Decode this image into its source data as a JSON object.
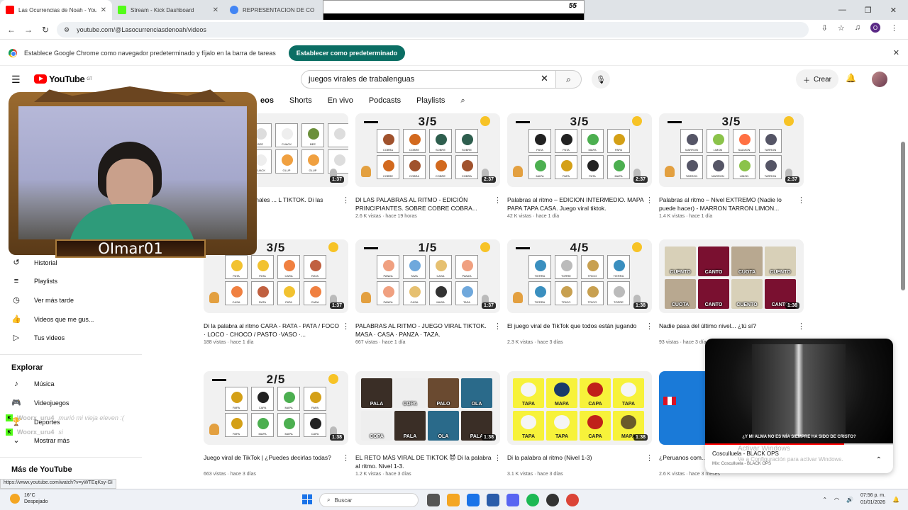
{
  "browser": {
    "tabs": [
      {
        "label": "Las Ocurrencias de Noah - YouT",
        "color": "#ff0000",
        "active": true
      },
      {
        "label": "Stream - Kick Dashboard",
        "color": "#53fc18",
        "active": false
      },
      {
        "label": "REPRESENTACION DE CO",
        "color": "#4285f4",
        "active": false
      }
    ],
    "overlay_number": "55",
    "url": "youtube.com/@Lasocurrenciasdenoah/videos",
    "profile_initial": "O",
    "infobar_text": "Establece Google Chrome como navegador predeterminado y fíjalo en la barra de tareas",
    "infobar_button": "Establecer como predeterminado"
  },
  "youtube": {
    "logo": "YouTube",
    "logo_region": "GT",
    "search_value": "juegos virales de trabalenguas",
    "create_label": "Crear",
    "channel_tabs": [
      "eos",
      "Shorts",
      "En vivo",
      "Podcasts",
      "Playlists"
    ]
  },
  "sidebar": {
    "items_top": [
      {
        "label": "Historial",
        "icon": "history-icon"
      },
      {
        "label": "Playlists",
        "icon": "playlist-icon"
      },
      {
        "label": "Ver más tarde",
        "icon": "clock-icon"
      },
      {
        "label": "Videos que me gus...",
        "icon": "like-icon"
      },
      {
        "label": "Tus videos",
        "icon": "video-icon"
      }
    ],
    "explore_heading": "Explorar",
    "items_explore": [
      {
        "label": "Música",
        "icon": "music-icon"
      },
      {
        "label": "Videojuegos",
        "icon": "gamepad-icon"
      },
      {
        "label": "Deportes",
        "icon": "trophy-icon"
      },
      {
        "label": "Mostrar más",
        "icon": "chevron-down-icon"
      }
    ],
    "more_heading": "Más de YouTube"
  },
  "webcam": {
    "name": "OImar01"
  },
  "chat": [
    {
      "user": "Woorx_uru4",
      "msg": "murió mi vieja eleven :("
    },
    {
      "user": "Woorx_uru4",
      "msg": "si"
    }
  ],
  "videos": [
    {
      "score": "",
      "title": "con sonidos de animales ... L TIKTOK. Di las palabras a...",
      "meta": "horas",
      "duration": "1:37",
      "type": "grid",
      "cells": [
        "BEE",
        "CUACK",
        "BEE",
        "",
        "CUACK",
        "GLUP",
        "GLUP",
        ""
      ],
      "colors": [
        "#ddd",
        "#eee",
        "#6b8f3a",
        "#ddd",
        "#eee",
        "#f0a040",
        "#f0a040",
        "#ddd"
      ]
    },
    {
      "score": "3/5",
      "title": "DI LAS PALABRAS AL RITMO - EDICIÓN PRINCIPIANTES. SOBRE COBRE COBRA...",
      "meta": "2.6 K vistas · hace 19 horas",
      "duration": "2:37",
      "type": "grid",
      "cells": [
        "COBRA",
        "COBRE",
        "SOBRE",
        "SOBRE",
        "COBRE",
        "COBRA",
        "COBRE",
        "COBRA"
      ],
      "colors": [
        "#a0522d",
        "#d2691e",
        "#2e5e4e",
        "#2e5e4e",
        "#d2691e",
        "#a0522d",
        "#d2691e",
        "#a0522d"
      ]
    },
    {
      "score": "3/5",
      "title": "Palabras al ritmo – EDICION INTERMEDIO. MAPA PAPA TAPA CASA. Juego viral tiktok.",
      "meta": "42 K vistas · hace 1 día",
      "duration": "2:37",
      "type": "grid",
      "cells": [
        "PATA",
        "PATA",
        "MAPA",
        "PAPA",
        "MAPA",
        "PAPA",
        "PATA",
        "MAPA"
      ],
      "colors": [
        "#222",
        "#222",
        "#4caf50",
        "#d4a017",
        "#4caf50",
        "#d4a017",
        "#222",
        "#4caf50"
      ]
    },
    {
      "score": "3/5",
      "title": "Palabras al ritmo – Nivel EXTREMO (Nadie lo puede hacer) - MARRON TARRON LIMON...",
      "meta": "1.4 K vistas · hace 1 día",
      "duration": "2:37",
      "type": "grid",
      "cells": [
        "MARRON",
        "LIMON",
        "SALMON",
        "TARRON",
        "TARRON",
        "MARRON",
        "LIMON",
        "TARRON"
      ],
      "colors": [
        "#556",
        "#8bc34a",
        "#ff7043",
        "#556",
        "#556",
        "#556",
        "#8bc34a",
        "#556"
      ]
    },
    {
      "score": "3/5",
      "title": "Di la palabra al ritmo CARA - RATA - PATA / FOCO · LOCO · CHOCO / PASTO ·VASO ·...",
      "meta": "188 vistas · hace 1 día",
      "duration": "1:37",
      "type": "grid",
      "cells": [
        "PATA",
        "PATA",
        "CARA",
        "RATA",
        "CASA",
        "RATA",
        "PATA",
        "CARA"
      ],
      "colors": [
        "#f2c230",
        "#f2c230",
        "#f08040",
        "#c06040",
        "#f08040",
        "#c06040",
        "#f2c230",
        "#f08040"
      ]
    },
    {
      "score": "1/5",
      "title": "PALABRAS AL RITMO - JUEGO VIRAL TIKTOK. MASA · CASA · PANZA · TAZA.",
      "meta": "667 vistas · hace 1 día",
      "duration": "1:37",
      "type": "grid",
      "cells": [
        "PANZA",
        "TAZA",
        "CASA",
        "PANZA",
        "PANZA",
        "CASA",
        "MASA",
        "TAZA"
      ],
      "colors": [
        "#f0a080",
        "#6fa8dc",
        "#e6c070",
        "#f0a080",
        "#f0a080",
        "#e6c070",
        "#333",
        "#6fa8dc"
      ]
    },
    {
      "score": "4/5",
      "title": "El juego viral de TikTok que todos están jugando",
      "meta": "2.3 K vistas · hace 3 días",
      "duration": "1:38",
      "type": "grid",
      "cells": [
        "TIERRA",
        "TORRE",
        "TRIGO",
        "TIERRA",
        "TIERRA",
        "TRIGO",
        "TRIGO",
        "TORRE"
      ],
      "colors": [
        "#3a8fbf",
        "#bbb",
        "#c8a050",
        "#3a8fbf",
        "#3a8fbf",
        "#c8a050",
        "#c8a050",
        "#bbb"
      ]
    },
    {
      "score": "",
      "title": "Nadie pasa del último nivel... ¿tú sí?",
      "meta": "93 vistas · hace 3 días",
      "duration": "1:38",
      "type": "photo",
      "cells": [
        "CUENTO",
        "CANTO",
        "CUOTA",
        "CUENTO",
        "CUOTA",
        "CANTO",
        "CUENTO",
        "CANTO"
      ],
      "colors": [
        "#d8d0b8",
        "#7a1030",
        "#b8a890",
        "#d8d0b8",
        "#b8a890",
        "#7a1030",
        "#d8d0b8",
        "#7a1030"
      ]
    },
    {
      "score": "2/5",
      "title": "Juego viral de TikTok | ¿Puedes decirlas todas?",
      "meta": "663 vistas · hace 3 días",
      "duration": "1:38",
      "type": "grid",
      "cells": [
        "PAPA",
        "CAPA",
        "MAPA",
        "PAPA",
        "PAPA",
        "MAPA",
        "MAPA",
        "CAPA"
      ],
      "colors": [
        "#d4a017",
        "#222",
        "#4caf50",
        "#d4a017",
        "#d4a017",
        "#4caf50",
        "#4caf50",
        "#222"
      ]
    },
    {
      "score": "",
      "title": "EL RETO MÁS VIRAL DE TIKTOK 😈 Di la palabra al ritmo. Nivel 1-3.",
      "meta": "1.2 K vistas · hace 3 días",
      "duration": "1:38",
      "type": "photo",
      "cells": [
        "PALA",
        "COPA",
        "PALO",
        "OLA",
        "COPA",
        "PALA",
        "OLA",
        "PALA"
      ],
      "colors": [
        "#3a2e26",
        "#eee",
        "#6a4a30",
        "#2a6a8a",
        "#eee",
        "#3a2e26",
        "#2a6a8a",
        "#3a2e26"
      ]
    },
    {
      "score": "",
      "title": "Di la palabra al ritmo (Nivel 1-3)",
      "meta": "3.1 K vistas · hace 3 días",
      "duration": "1:38",
      "type": "photo-yellow",
      "cells": [
        "TAPA",
        "MAPA",
        "CAPA",
        "TAPA",
        "TAPA",
        "TAPA",
        "CAPA",
        "MAPA"
      ],
      "colors": [
        "#f5f5f5",
        "#1a3a6a",
        "#c0201a",
        "#f5f5f5",
        "#f5f5f5",
        "#f5f5f5",
        "#c0201a",
        "#6a5a2a"
      ]
    },
    {
      "score": "",
      "title": "¿Peruanos com... de Noah Podca...",
      "meta": "2.6 K vistas · hace 3 meses",
      "duration": "",
      "type": "peru",
      "cells": [],
      "colors": []
    }
  ],
  "player": {
    "caption": "¿Y MI ALMA NO ES MÍA SIEMPRE HA SIDO DE CRISTO?",
    "title": "Cosculluela - BLACK OPS",
    "subtitle": "Mix: Cosculluela - BLACK OPS",
    "progress": 0.74
  },
  "watermark": {
    "line1": "Activar Windows",
    "line2": "Ve a Configuración para activar Windows."
  },
  "status_url": "https://www.youtube.com/watch?v=yWTEqKsy-GI",
  "taskbar": {
    "temp": "16°C",
    "weather": "Despejado",
    "search": "Buscar",
    "time": "07:56 p. m.",
    "date": "01/01/2026"
  }
}
